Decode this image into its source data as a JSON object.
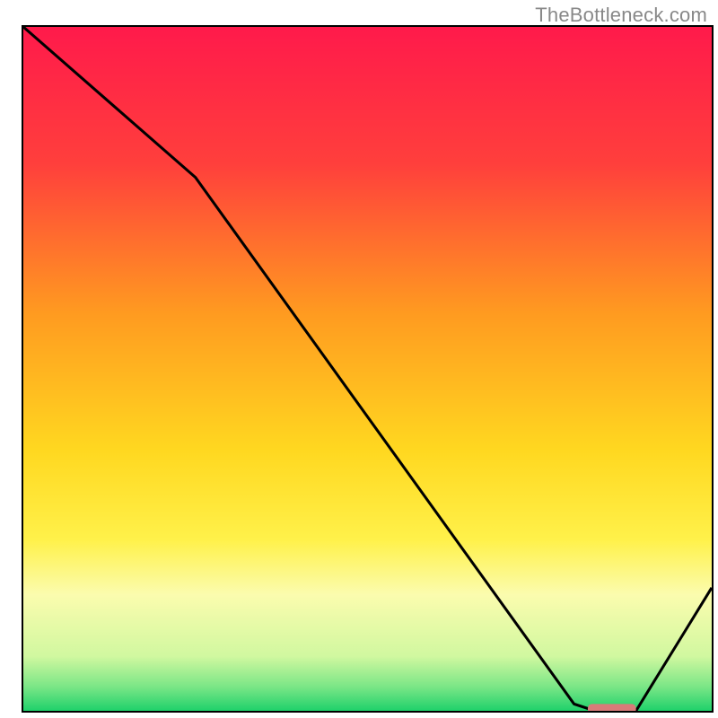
{
  "watermark": "TheBottleneck.com",
  "colors": {
    "gradient": [
      {
        "offset": 0,
        "color": "#ff1a4b"
      },
      {
        "offset": 20,
        "color": "#ff3f3c"
      },
      {
        "offset": 42,
        "color": "#ff9b20"
      },
      {
        "offset": 62,
        "color": "#ffd820"
      },
      {
        "offset": 75,
        "color": "#fff14a"
      },
      {
        "offset": 83,
        "color": "#fbfcae"
      },
      {
        "offset": 92,
        "color": "#d1f8a0"
      },
      {
        "offset": 96.5,
        "color": "#7ae686"
      },
      {
        "offset": 100,
        "color": "#1fd16b"
      }
    ],
    "frame": "#000000",
    "curve": "#000000",
    "marker": "#d87b79"
  },
  "chart_data": {
    "type": "line",
    "x": [
      0,
      25,
      80,
      83,
      89,
      100
    ],
    "values": [
      100,
      78,
      1,
      0,
      0,
      18
    ],
    "title": "",
    "xlabel": "",
    "ylabel": "",
    "xlim": [
      0,
      100
    ],
    "ylim": [
      0,
      100
    ],
    "marker": {
      "x_start": 82,
      "x_end": 89,
      "y": 0
    }
  }
}
